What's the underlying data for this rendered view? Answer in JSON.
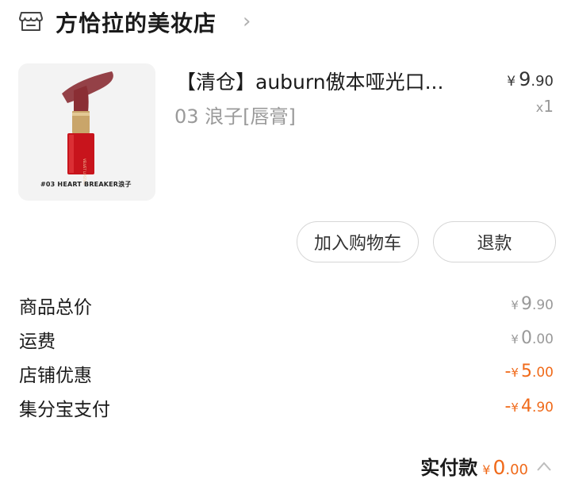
{
  "shop": {
    "name": "方恰拉的美妆店",
    "icon": "store-icon",
    "chevron_icon": "chevron-right-icon"
  },
  "product": {
    "title": "【清仓】auburn傲本哑光口...",
    "variant": "03 浪子[唇膏]",
    "image_caption": "#03 HEART BREAKER浪子",
    "price": {
      "currency": "¥",
      "integer": "9",
      "decimal": ".90"
    },
    "quantity": {
      "prefix": "x",
      "value": "1"
    }
  },
  "actions": {
    "add_to_cart": "加入购物车",
    "refund": "退款"
  },
  "summary": [
    {
      "label": "商品总价",
      "sign": "",
      "currency": "¥",
      "integer": "9",
      "decimal": ".90"
    },
    {
      "label": "运费",
      "sign": "",
      "currency": "¥",
      "integer": "0",
      "decimal": ".00"
    },
    {
      "label": "店铺优惠",
      "sign": "-",
      "currency": "¥",
      "integer": "5",
      "decimal": ".00"
    },
    {
      "label": "集分宝支付",
      "sign": "-",
      "currency": "¥",
      "integer": "4",
      "decimal": ".90"
    }
  ],
  "paid": {
    "label": "实付款",
    "currency": "¥",
    "integer": "0",
    "decimal": ".00",
    "chevron_icon": "chevron-up-icon"
  },
  "colors": {
    "accent": "#f06a1a",
    "muted": "#999999",
    "lipstick_red": "#c8141c",
    "bullet": "#8a2e34"
  }
}
